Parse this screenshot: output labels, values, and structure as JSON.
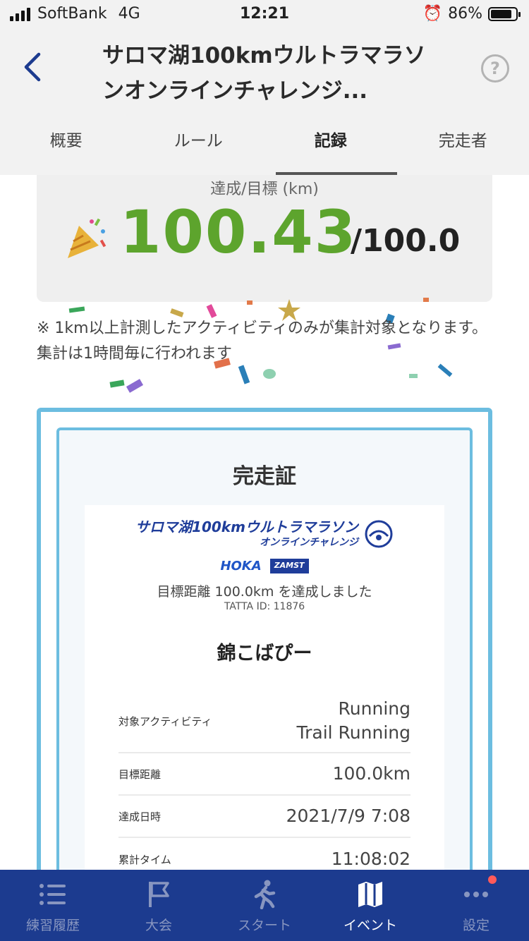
{
  "status_bar": {
    "carrier": "SoftBank",
    "network": "4G",
    "time": "12:21",
    "battery": "86%"
  },
  "header": {
    "title": "サロマ湖100kmウルトラマラソンオンラインチャレンジ..."
  },
  "tabs": [
    {
      "label": "概要"
    },
    {
      "label": "ルール"
    },
    {
      "label": "記録"
    },
    {
      "label": "完走者"
    }
  ],
  "record": {
    "label": "達成/目標 (km)",
    "achieved": "100.43",
    "goal": "/100.0"
  },
  "note": "※ 1km以上計測したアクティビティのみが集計対象となります。集計は1時間毎に行われます",
  "certificate": {
    "title": "完走証",
    "logo_line1": "サロマ湖100kmウルトラマラソン",
    "logo_line2": "オンラインチャレンジ",
    "sponsor1": "HOKA",
    "sponsor2": "ZAMST",
    "achieved_text": "目標距離 100.0km を達成しました",
    "tatta_id": "TATTA ID: 11876",
    "name": "錦こばぴー",
    "rows": [
      {
        "key": "対象アクティビティ",
        "value1": "Running",
        "value2": "Trail Running"
      },
      {
        "key": "目標距離",
        "value": "100.0km"
      },
      {
        "key": "達成日時",
        "value": "2021/7/9 7:08"
      },
      {
        "key": "累計タイム",
        "value": "11:08:02"
      }
    ]
  },
  "tabbar": [
    {
      "label": "練習履歴",
      "icon": "list-icon"
    },
    {
      "label": "大会",
      "icon": "flag-icon"
    },
    {
      "label": "スタート",
      "icon": "runner-icon"
    },
    {
      "label": "イベント",
      "icon": "map-icon"
    },
    {
      "label": "設定",
      "icon": "more-icon"
    }
  ],
  "colors": {
    "accent_blue": "#1c3b8f",
    "record_green": "#5da42d",
    "cert_border": "#6cbde0"
  }
}
